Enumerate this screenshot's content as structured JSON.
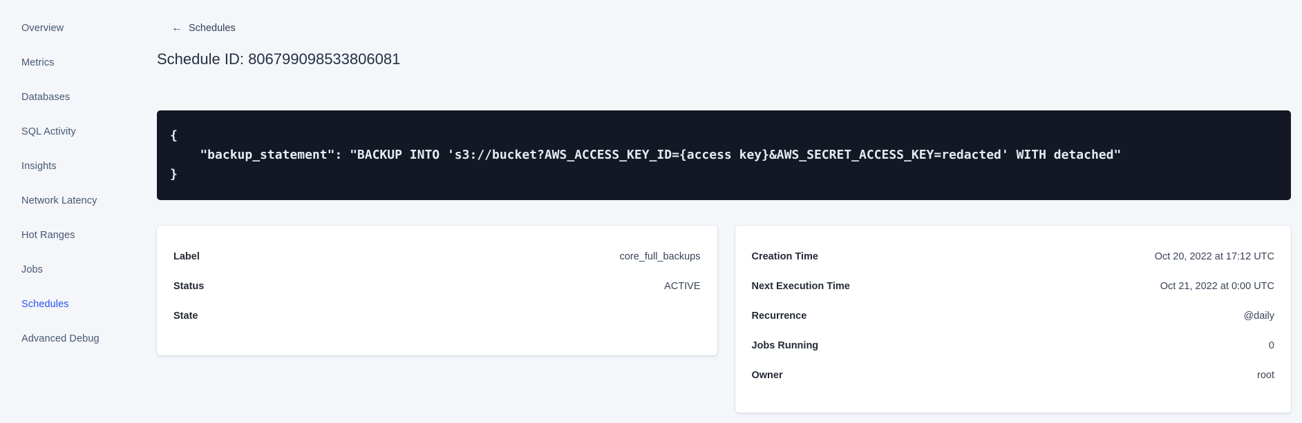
{
  "colors": {
    "page_background": "#f4f6fa",
    "sidebar_text": "#475872",
    "active_nav_blue": "#2a53f0",
    "code_block_background": "#131824",
    "code_text": "#e7ebf2",
    "card_background": "#ffffff"
  },
  "sidebar": {
    "items": [
      {
        "label": "Overview",
        "active": false
      },
      {
        "label": "Metrics",
        "active": false
      },
      {
        "label": "Databases",
        "active": false
      },
      {
        "label": "SQL Activity",
        "active": false
      },
      {
        "label": "Insights",
        "active": false
      },
      {
        "label": "Network Latency",
        "active": false
      },
      {
        "label": "Hot Ranges",
        "active": false
      },
      {
        "label": "Jobs",
        "active": false
      },
      {
        "label": "Schedules",
        "active": true
      },
      {
        "label": "Advanced Debug",
        "active": false
      }
    ]
  },
  "header": {
    "back_icon_glyph": "←",
    "back_link_label": "Schedules",
    "title": "Schedule ID: 806799098533806081"
  },
  "code_block": {
    "lines": [
      "{",
      "    \"backup_statement\": \"BACKUP INTO 's3://bucket?AWS_ACCESS_KEY_ID={access key}&AWS_SECRET_ACCESS_KEY=redacted' WITH detached\"",
      "}"
    ]
  },
  "details_card": {
    "rows": [
      {
        "label": "Label",
        "value": "core_full_backups"
      },
      {
        "label": "Status",
        "value": "ACTIVE"
      },
      {
        "label": "State",
        "value": ""
      }
    ]
  },
  "timing_card": {
    "rows": [
      {
        "label": "Creation Time",
        "value": "Oct 20, 2022 at 17:12 UTC"
      },
      {
        "label": "Next Execution Time",
        "value": "Oct 21, 2022 at 0:00 UTC"
      },
      {
        "label": "Recurrence",
        "value": "@daily"
      },
      {
        "label": "Jobs Running",
        "value": "0"
      },
      {
        "label": "Owner",
        "value": "root"
      }
    ]
  }
}
